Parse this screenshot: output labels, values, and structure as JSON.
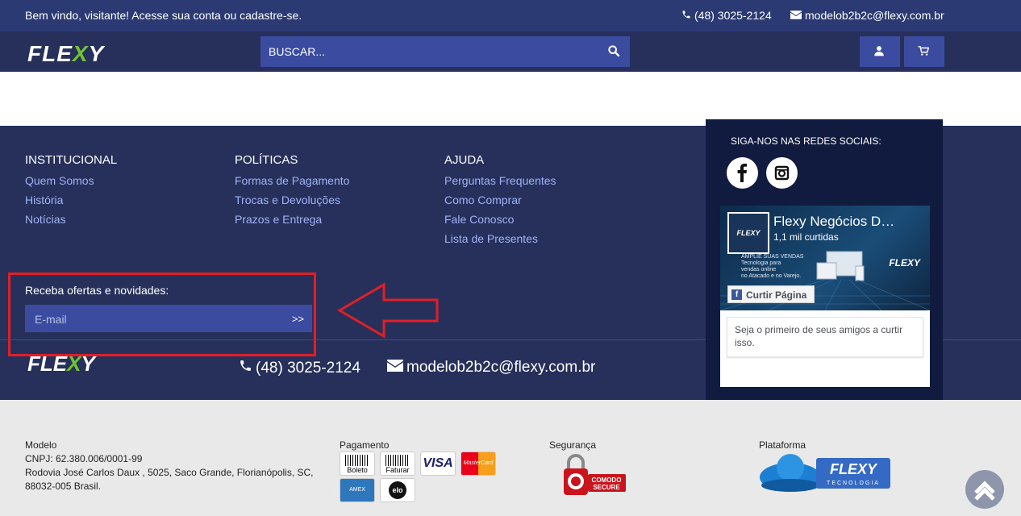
{
  "topbar": {
    "welcome": "Bem vindo, visitante! Acesse sua conta ou cadastre-se.",
    "phone": "(48) 3025-2124",
    "email": "modelob2b2c@flexy.com.br"
  },
  "header": {
    "logo": "FLEXY",
    "search_placeholder": "BUSCAR..."
  },
  "footer": {
    "columns": [
      {
        "title": "INSTITUCIONAL",
        "links": [
          "Quem Somos",
          "História",
          "Notícias"
        ]
      },
      {
        "title": "POLÍTICAS",
        "links": [
          "Formas de Pagamento",
          "Trocas e Devoluções",
          "Prazos e Entrega"
        ]
      },
      {
        "title": "AJUDA",
        "links": [
          "Perguntas Frequentes",
          "Como Comprar",
          "Fale Conosco",
          "Lista de Presentes"
        ]
      }
    ],
    "newsletter": {
      "label": "Receba ofertas e novidades:",
      "placeholder": "E-mail",
      "button": ">>"
    },
    "logo": "FLEXY",
    "phone": "(48) 3025-2124",
    "email": "modelob2b2c@flexy.com.br"
  },
  "social": {
    "title": "SIGA-NOS NAS REDES SOCIAIS:",
    "fb_page_name": "Flexy Negócios D…",
    "fb_likes": "1,1 mil curtidas",
    "fb_like_button": "Curtir Página",
    "fb_friends": "Seja o primeiro de seus amigos a curtir isso.",
    "fb_thumb": "FLEXY",
    "fb_ad_text": [
      "AMPLIE SUAS VENDAS",
      "Tecnologia para",
      "vendas online",
      "no Atacado e no Varejo."
    ],
    "fb_ad_logo": "FLEXY"
  },
  "lower": {
    "company": {
      "lines": [
        "Modelo",
        "CNPJ: 62.380.006/0001-99",
        "Rodovia José Carlos Daux , 5025, Saco Grande, Florianópolis, SC,",
        "88032-005 Brasil."
      ]
    },
    "payment_title": "Pagamento",
    "payment_methods": [
      "Boleto",
      "Faturar",
      "VISA",
      "MasterCard",
      "AMEX",
      "elo"
    ],
    "security_title": "Segurança",
    "security_badge": [
      "COMODO",
      "SECURE"
    ],
    "platform_title": "Plataforma",
    "platform_badge": [
      "FLEXY",
      "TECNOLOGIA"
    ]
  }
}
